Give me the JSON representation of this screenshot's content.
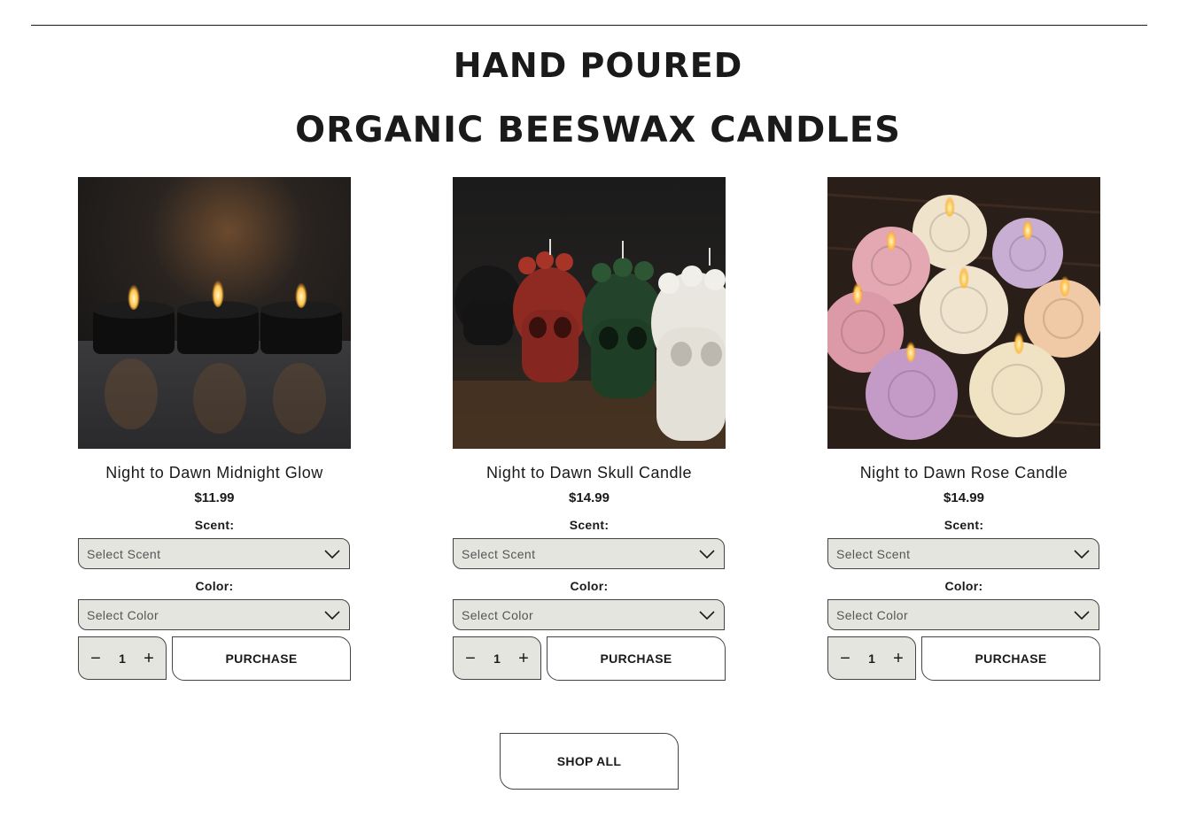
{
  "headline": {
    "line1": "HAND POURED",
    "line2": "ORGANIC BEESWAX CANDLES"
  },
  "products": [
    {
      "title": "Night to Dawn Midnight Glow",
      "price": "$11.99",
      "scent_label": "Scent:",
      "scent_placeholder": "Select Scent",
      "color_label": "Color:",
      "color_placeholder": "Select Color",
      "quantity": "1",
      "purchase_label": "PURCHASE",
      "image": "black-tin-candles-photo"
    },
    {
      "title": "Night to Dawn Skull Candle",
      "price": "$14.99",
      "scent_label": "Scent:",
      "scent_placeholder": "Select Scent",
      "color_label": "Color:",
      "color_placeholder": "Select Color",
      "quantity": "1",
      "purchase_label": "PURCHASE",
      "image": "skull-candles-photo"
    },
    {
      "title": "Night to Dawn Rose Candle",
      "price": "$14.99",
      "scent_label": "Scent:",
      "scent_placeholder": "Select Scent",
      "color_label": "Color:",
      "color_placeholder": "Select Color",
      "quantity": "1",
      "purchase_label": "PURCHASE",
      "image": "rose-candles-photo"
    }
  ],
  "shop_all_label": "SHOP ALL",
  "colors": {
    "text": "#1a1a1a",
    "select_bg": "#e5e5e0",
    "border": "#444444"
  }
}
